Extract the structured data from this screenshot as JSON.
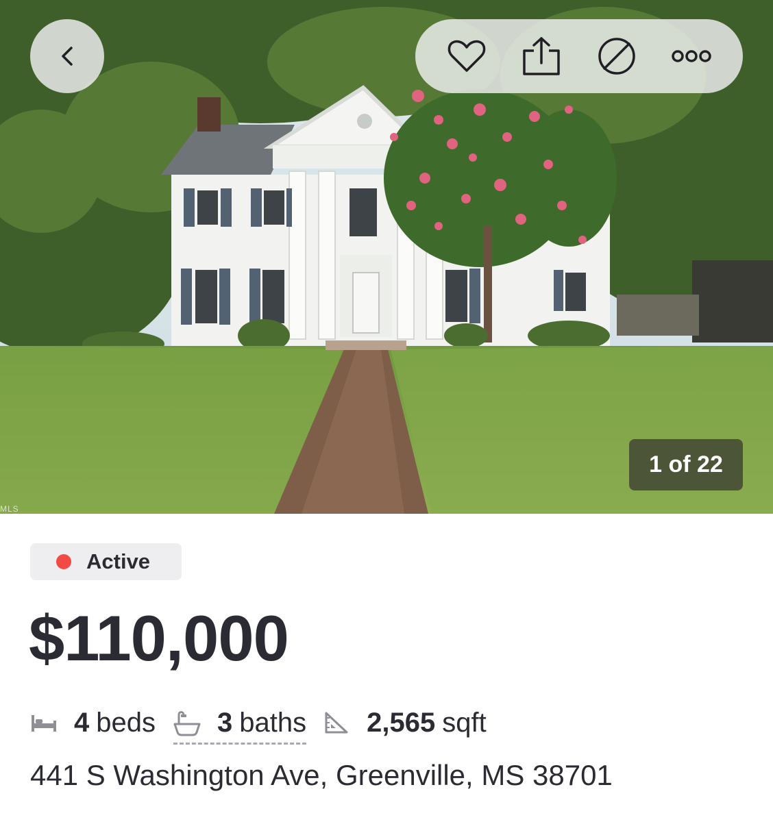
{
  "colors": {
    "status_active": "#f24a44",
    "text_primary": "#2b2b33",
    "status_background": "#eeeef1",
    "button_background": "rgba(240,240,242,0.82)"
  },
  "header": {
    "back_icon": "chevron-left-icon",
    "actions": [
      {
        "icon": "heart-icon"
      },
      {
        "icon": "share-icon"
      },
      {
        "icon": "hide-icon"
      },
      {
        "icon": "more-icon"
      }
    ]
  },
  "gallery": {
    "counter": "1 of 22",
    "watermark": "MLS"
  },
  "listing": {
    "status": "Active",
    "price": "$110,000",
    "beds_value": "4",
    "beds_label": "beds",
    "baths_value": "3",
    "baths_label": "baths",
    "sqft_value": "2,565",
    "sqft_label": "sqft",
    "address": "441 S Washington Ave, Greenville, MS 38701"
  }
}
